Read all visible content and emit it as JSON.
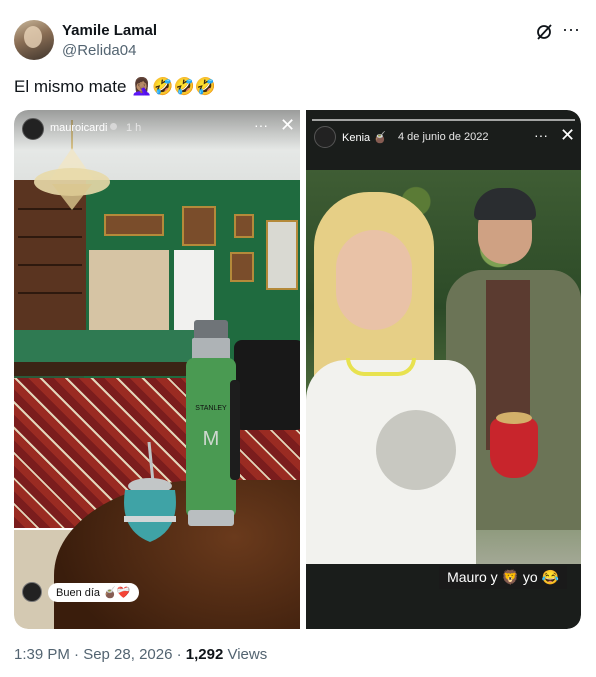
{
  "author": {
    "name": "Yamile Lamal",
    "handle": "@Relida04"
  },
  "tweet": {
    "text": "El mismo mate 🤦🏽‍♀️🤣🤣🤣"
  },
  "story_left": {
    "username": "mauroicardi",
    "time": "1 h",
    "more_label": "···",
    "close_label": "✕",
    "reply_text": "Buen día 🧉❤️‍🩹"
  },
  "story_right": {
    "username": "Kenia 🧉",
    "date": "4 de junio de 2022",
    "more_label": "···",
    "close_label": "✕",
    "caption": "Mauro y 🦁 yo 😂"
  },
  "meta": {
    "time": "1:39 PM · Sep 28, 2026 · ",
    "views_count": "1,292",
    "views_label": " Views"
  },
  "icons": {
    "grok": "grok-icon",
    "more": "more-icon"
  },
  "colors": {
    "text": "#0f1419",
    "secondary": "#536471"
  }
}
